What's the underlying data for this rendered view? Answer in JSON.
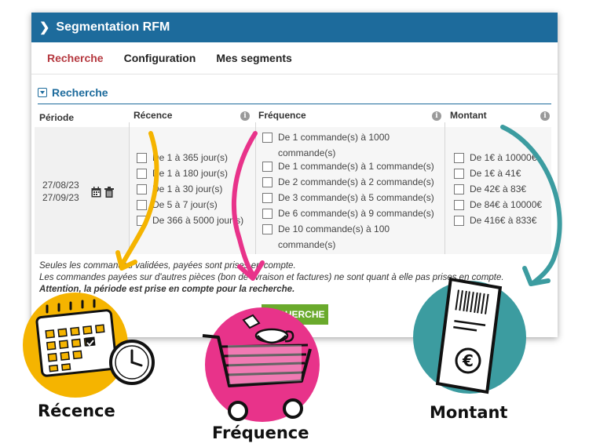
{
  "header": {
    "title": "Segmentation RFM"
  },
  "tabs": [
    {
      "label": "Recherche"
    },
    {
      "label": "Configuration"
    },
    {
      "label": "Mes segments"
    }
  ],
  "section": {
    "title": "Recherche"
  },
  "columns": {
    "periode": "Période",
    "recence": "Récence",
    "frequence": "Fréquence",
    "montant": "Montant"
  },
  "period": {
    "from": "27/08/23",
    "to": "27/09/23"
  },
  "recence_options": [
    "De 1 à 365 jour(s)",
    "De 1 à 180 jour(s)",
    "De 1 à 30 jour(s)",
    "De 5 à 7 jour(s)",
    "De 366 à 5000 jour(s)"
  ],
  "frequence_options": [
    "De 1 commande(s) à 1000 commande(s)",
    "De 1 commande(s) à 1 commande(s)",
    "De 2 commande(s) à 2 commande(s)",
    "De 3 commande(s) à 5 commande(s)",
    "De 6 commande(s) à 9 commande(s)",
    "De 10 commande(s) à 100 commande(s)"
  ],
  "montant_options": [
    "De 1€ à 10000€",
    "De 1€ à 41€",
    "De 42€ à 83€",
    "De 84€ à 10000€",
    "De 416€ à 833€"
  ],
  "notes": {
    "line1": "Seules les commandes validées, payées sont prises en compte.",
    "line2": "Les commandes payées sur d'autres pièces (bon de livraison et factures) ne sont quant à elle pas prises en compte.",
    "line3": "Attention, la période est prise en compte pour la recherche."
  },
  "search_button": "RECHERCHE",
  "illustrations": {
    "recence": "Récence",
    "frequence": "Fréquence",
    "montant": "Montant"
  },
  "colors": {
    "header": "#1d6b9c",
    "active_tab": "#b5383f",
    "button": "#6aaa2c",
    "yellow": "#f5b400",
    "pink": "#e8338a",
    "teal": "#3c9ca0"
  }
}
